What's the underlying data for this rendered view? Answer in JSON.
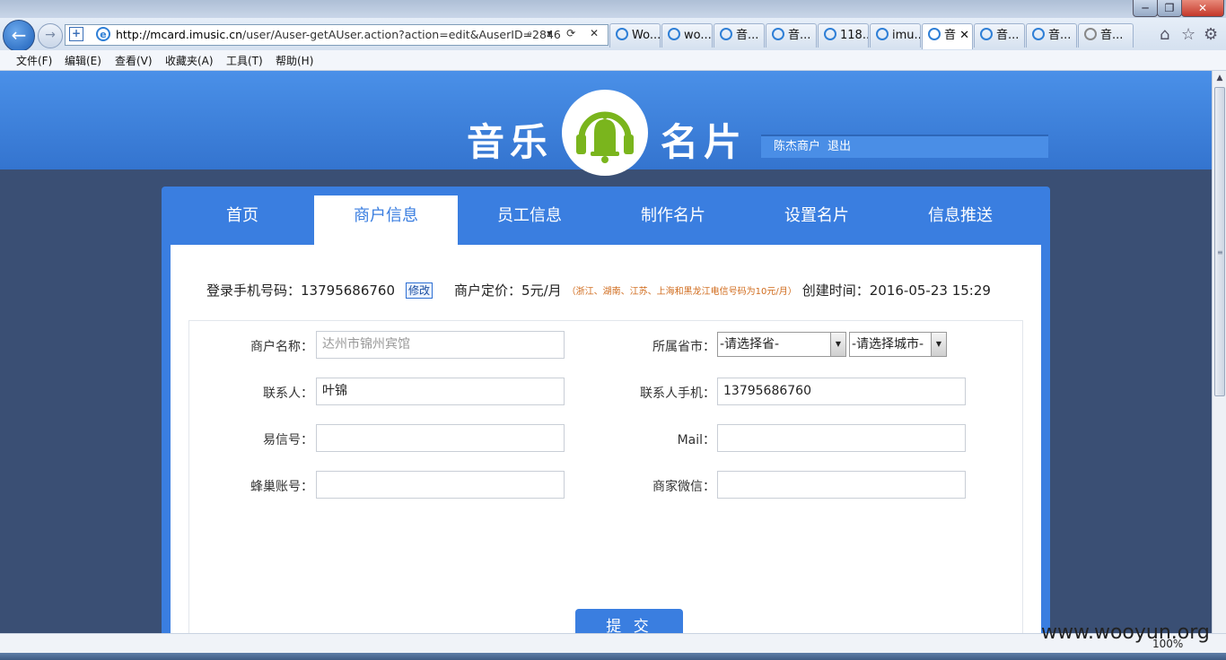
{
  "browser": {
    "window_controls": {
      "minimize": "─",
      "maximize": "❐",
      "close": "✕"
    },
    "address_host": "http://mcard.imusic.cn",
    "address_path": "/user/Auser-getAUser.action?action=edit&AuserID=2846",
    "address_tools": "⌕ ▾ ⟳ ✕",
    "tabs": [
      {
        "label": "Wo..."
      },
      {
        "label": "wo..."
      },
      {
        "label": "音..."
      },
      {
        "label": "音..."
      },
      {
        "label": "118..."
      },
      {
        "label": "imu..."
      },
      {
        "label": "音 ✕"
      },
      {
        "label": "音..."
      },
      {
        "label": "音..."
      },
      {
        "label": "音..."
      }
    ],
    "menu": [
      "文件(F)",
      "编辑(E)",
      "查看(V)",
      "收藏夹(A)",
      "工具(T)",
      "帮助(H)"
    ],
    "zoom": "100%",
    "watermark": "www.wooyun.org",
    "accent_color": "#2f7fd6"
  },
  "site": {
    "logo_left": "音乐",
    "logo_right": "名片",
    "user_name": "陈杰商户",
    "logout_label": "退出",
    "nav_tabs": [
      {
        "label": "首页"
      },
      {
        "label": "商户信息"
      },
      {
        "label": "员工信息"
      },
      {
        "label": "制作名片"
      },
      {
        "label": "设置名片"
      },
      {
        "label": "信息推送"
      }
    ],
    "active_tab": "商户信息",
    "brand_color": "#3a7ee0",
    "logo_green": "#7ab51d"
  },
  "info": {
    "phone_label": "登录手机号码：",
    "phone_value": "13795686760",
    "edit_label": "修改",
    "price_label": "商户定价：",
    "price_value": "5元/月",
    "price_note": "（浙江、湖南、江苏、上海和黑龙江电信号码为10元/月）",
    "created_label": "创建时间：",
    "created_value": "2016-05-23 15:29"
  },
  "form": {
    "merchant_name_label": "商户名称：",
    "merchant_name_value": "达州市锦州宾馆",
    "province_label": "所属省市：",
    "province_value": "-请选择省-",
    "city_value": "-请选择城市-",
    "contact_label": "联系人：",
    "contact_value": "叶锦",
    "contact_phone_label": "联系人手机：",
    "contact_phone_value": "13795686760",
    "yixin_label": "易信号：",
    "yixin_value": "",
    "mail_label": "Mail：",
    "mail_value": "",
    "hive_label": "蜂巢账号：",
    "hive_value": "",
    "wechat_label": "商家微信：",
    "wechat_value": "",
    "submit_label": "提 交"
  }
}
